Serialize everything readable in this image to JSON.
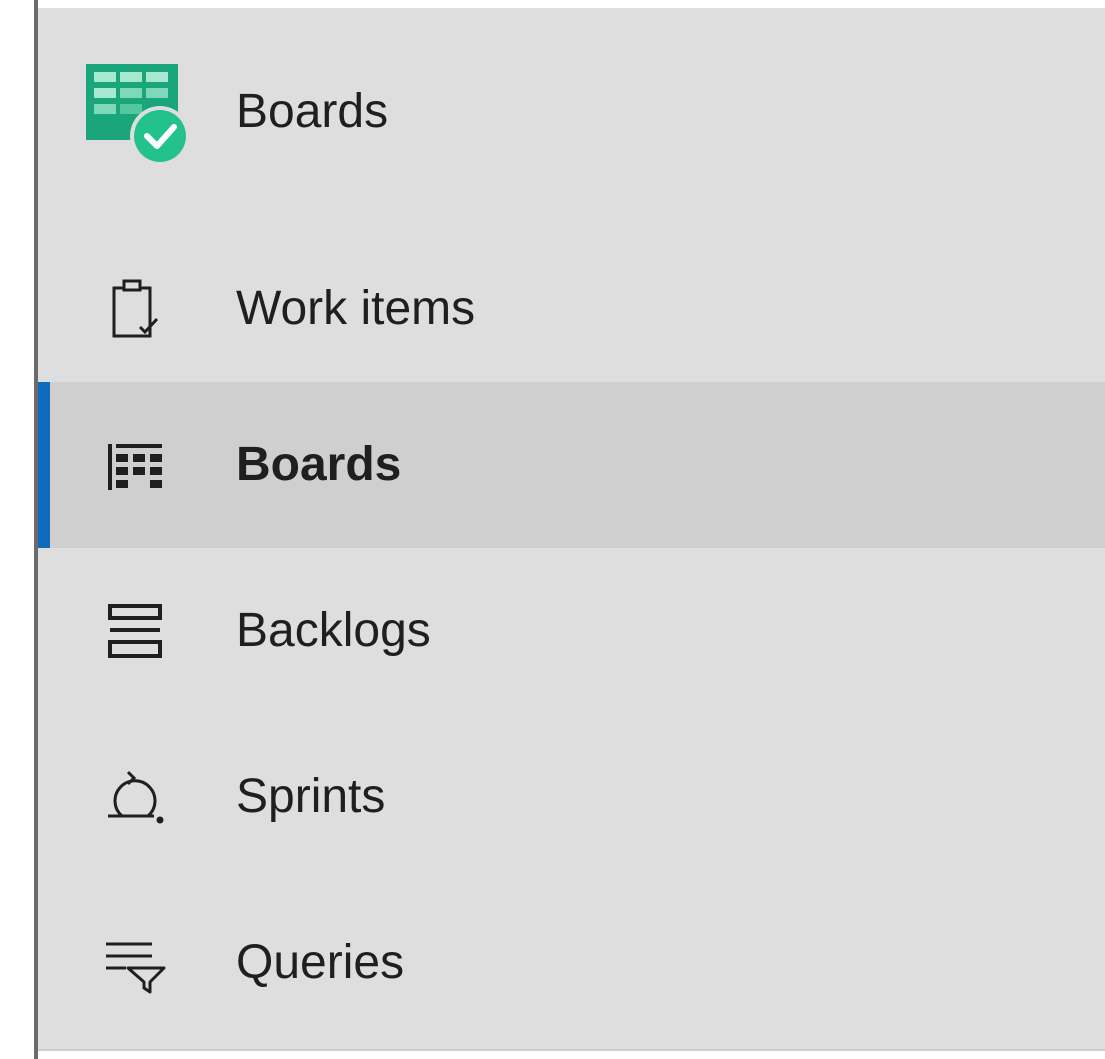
{
  "header": {
    "title": "Boards",
    "logo_icon": "azure-boards-logo-icon",
    "logo_colors": {
      "green": "#1aa57a",
      "light": "#a6e8d0",
      "check_bg": "#23c28d"
    }
  },
  "nav": {
    "items": [
      {
        "label": "Work items",
        "icon": "clipboard-check-icon",
        "selected": false
      },
      {
        "label": "Boards",
        "icon": "board-grid-icon",
        "selected": true
      },
      {
        "label": "Backlogs",
        "icon": "backlog-list-icon",
        "selected": false
      },
      {
        "label": "Sprints",
        "icon": "sprint-cycle-icon",
        "selected": false
      },
      {
        "label": "Queries",
        "icon": "query-filter-icon",
        "selected": false
      }
    ]
  },
  "colors": {
    "panel_bg": "#dedede",
    "selected_bg": "#cfcfcf",
    "accent": "#0f6cbd",
    "text": "#1f1f1f"
  }
}
